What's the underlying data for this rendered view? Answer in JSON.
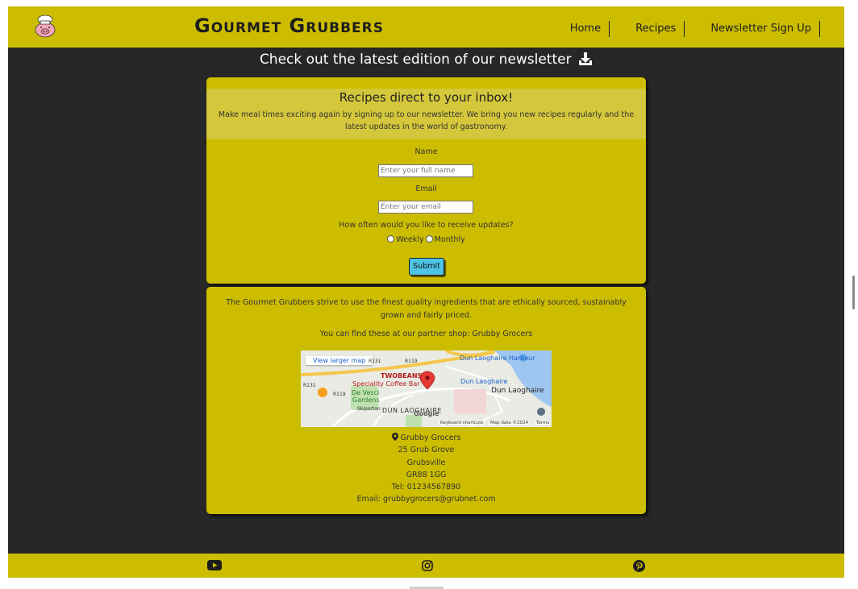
{
  "header": {
    "brand": "Gourmet Grubbers",
    "nav": [
      "Home",
      "Recipes",
      "Newsletter Sign Up"
    ]
  },
  "headline": "Check out the latest edition of our newsletter",
  "newsletter": {
    "title": "Recipes direct to your inbox!",
    "text": "Make meal times exciting again by signing up to our newsletter. We bring you new recipes regularly and the latest updates in the world of gastronomy.",
    "name_label": "Name",
    "name_placeholder": "Enter your full name",
    "email_label": "Email",
    "email_placeholder": "Enter your email",
    "frequency_label": "How often would you like to receive updates?",
    "options": [
      "Weekly",
      "Monthly"
    ],
    "submit": "Submit"
  },
  "info": {
    "text": "The Gourmet Grubbers strive to use the finest quality ingredients that are ethically sourced, sustainably grown and fairly priced.",
    "partner": "You can find these at our partner shop: Grubby Grocers",
    "map": {
      "larger_link": "View larger map",
      "labels": {
        "harbour": "Dun Laoghaire Harbour",
        "twobeans": "TWOBEANS",
        "coffee": "Speciality Coffee Bar",
        "station": "Dun Laoghaire",
        "town": "Dun Laoghaire",
        "gardens1": "De Vesci",
        "gardens2": "Gardens",
        "area": "DÚN LAOGHAIRE",
        "road1": "R119",
        "road2": "R131",
        "road3": "R119",
        "road4": "R131",
        "skiporton": "Skiporton",
        "google": "Google",
        "shortcuts": "Keyboard shortcuts",
        "mapdata": "Map data ©2024",
        "terms": "Terms"
      }
    },
    "address": {
      "name": "Grubby Grocers",
      "street": "25 Grub Grove",
      "town": "Grubsville",
      "postcode": "GR88 1GG",
      "tel": "Tel: 01234567890",
      "email": "Email: grubbygrocers@grubnet.com"
    }
  },
  "footer": {
    "icons": [
      "youtube-icon",
      "instagram-icon",
      "pinterest-icon"
    ]
  },
  "colors": {
    "brand_yellow": "#cdbd00",
    "background": "#272727",
    "submit_blue": "#4fc3e6"
  }
}
